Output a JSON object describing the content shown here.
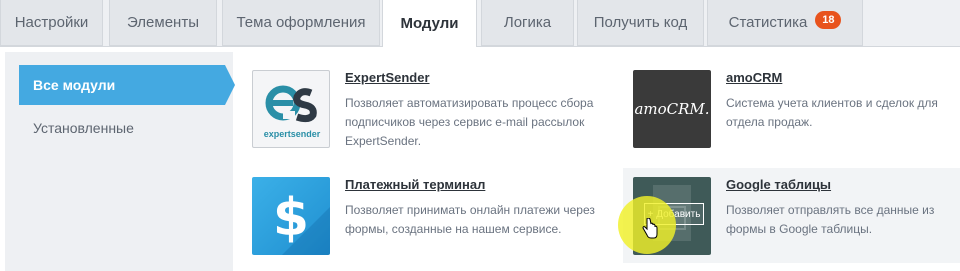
{
  "tabs": [
    {
      "label": "Настройки"
    },
    {
      "label": "Элементы"
    },
    {
      "label": "Тема оформления"
    },
    {
      "label": "Модули"
    },
    {
      "label": "Логика"
    },
    {
      "label": "Получить код"
    },
    {
      "label": "Статистика",
      "badge": "18"
    }
  ],
  "sidebar": {
    "items": [
      {
        "label": "Все модули",
        "active": true
      },
      {
        "label": "Установленные",
        "active": false
      }
    ]
  },
  "modules": [
    {
      "title": "ExpertSender",
      "description": "Позволяет автоматизировать процесс сбора подписчиков через сервис e-mail рассылок ExpertSender.",
      "logo_text": "expertsender",
      "icon": "expertsender-logo-icon"
    },
    {
      "title": "amoCRM",
      "description": "Система учета клиентов и сделок для отдела продаж.",
      "logo_text": "amoCRM.",
      "icon": "amocrm-logo-icon"
    },
    {
      "title": "Платежный терминал",
      "description": "Позволяет принимать онлайн платежи через формы, созданные на нашем сервисе.",
      "icon": "dollar-icon"
    },
    {
      "title": "Google таблицы",
      "description": "Позволяет отправлять все данные из формы в Google таблицы.",
      "add_label": "+ Добавить",
      "icon": "google-sheets-icon"
    }
  ],
  "colors": {
    "accent": "#44a9e1",
    "badge": "#e8531d",
    "cursor_highlight": "#f0f028"
  }
}
